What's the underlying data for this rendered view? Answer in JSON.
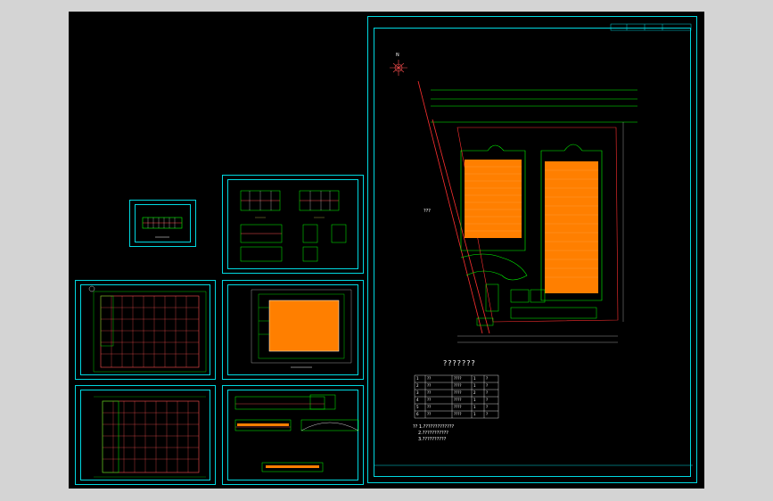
{
  "drawing": {
    "site_plan": {
      "north_label": "N",
      "legend_title": "???????",
      "side_label": "???",
      "legend_rows": [
        {
          "no": "1",
          "name": "??",
          "area": "????",
          "floors": "1",
          "note": "?"
        },
        {
          "no": "2",
          "name": "??",
          "area": "????",
          "floors": "1",
          "note": "?"
        },
        {
          "no": "3",
          "name": "??",
          "area": "????",
          "floors": "2",
          "note": "?"
        },
        {
          "no": "4",
          "name": "??",
          "area": "????",
          "floors": "1",
          "note": "?"
        },
        {
          "no": "5",
          "name": "??",
          "area": "????",
          "floors": "1",
          "note": "?"
        },
        {
          "no": "6",
          "name": "??",
          "area": "????",
          "floors": "1",
          "note": "?"
        }
      ],
      "notes": [
        "?? 1.?????????????",
        "2.???????????",
        "3.??????????"
      ]
    },
    "colors": {
      "background": "#000000",
      "frame": "#00d8e0",
      "grid": "#00ff00",
      "building_fill": "#ff7f00",
      "road": "#ff0000",
      "text": "#ffffff"
    }
  }
}
